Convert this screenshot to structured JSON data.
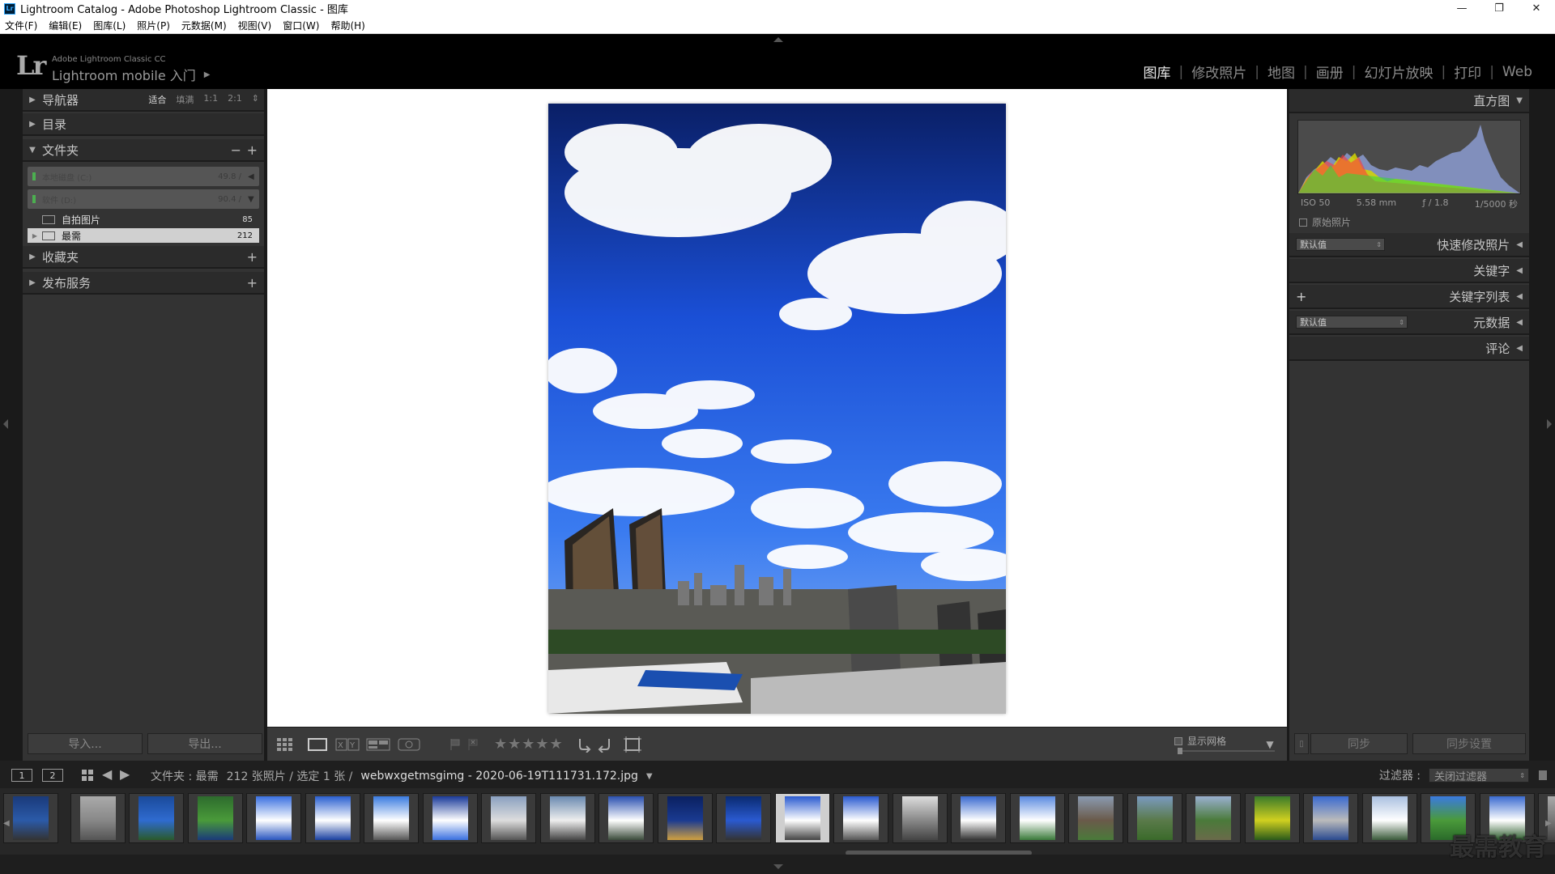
{
  "window": {
    "title": "Lightroom Catalog - Adobe Photoshop Lightroom Classic - 图库",
    "icon_label": "Lr",
    "minimize": "—",
    "restore": "❐",
    "close": "✕"
  },
  "menu": [
    "文件(F)",
    "编辑(E)",
    "图库(L)",
    "照片(P)",
    "元数据(M)",
    "视图(V)",
    "窗口(W)",
    "帮助(H)"
  ],
  "identity": {
    "logo": "Lr",
    "product": "Adobe Lightroom Classic CC",
    "mobile": "Lightroom mobile 入门"
  },
  "modules": [
    "图库",
    "修改照片",
    "地图",
    "画册",
    "幻灯片放映",
    "打印",
    "Web"
  ],
  "active_module": "图库",
  "left_panel": {
    "navigator": {
      "label": "导航器",
      "zoom": [
        "适合",
        "填满",
        "1:1",
        "2:1"
      ]
    },
    "catalog": {
      "label": "目录"
    },
    "folders": {
      "label": "文件夹",
      "volumes": [
        {
          "name": "本地磁盘 (C:)",
          "size": "49.8 / "
        },
        {
          "name": "软件 (D:)",
          "size": "90.4 / "
        }
      ],
      "items": [
        {
          "name": "自拍图片",
          "count": "85"
        },
        {
          "name": "最需",
          "count": "212"
        }
      ]
    },
    "collections": {
      "label": "收藏夹"
    },
    "publish": {
      "label": "发布服务"
    },
    "import_label": "导入...",
    "export_label": "导出..."
  },
  "right_panel": {
    "histogram": {
      "label": "直方图",
      "iso": "ISO 50",
      "focal": "5.58 mm",
      "aperture": "ƒ / 1.8",
      "shutter": "1/5000 秒"
    },
    "original_photo": "原始照片",
    "quick_develop": {
      "label": "快速修改照片",
      "preset": "默认值"
    },
    "keywording": {
      "label": "关键字"
    },
    "keyword_list": {
      "label": "关键字列表"
    },
    "metadata": {
      "label": "元数据",
      "preset": "默认值"
    },
    "comments": {
      "label": "评论"
    },
    "sync_label": "同步",
    "sync_settings_label": "同步设置"
  },
  "toolbar": {
    "stars": "★★★★★",
    "show_grid": "显示网格"
  },
  "filmstrip": {
    "screen1": "1",
    "screen2": "2",
    "breadcrumb_folder": "文件夹 : 最需",
    "count": "212 张照片 / 选定 1 张 /",
    "file_name": "webwxgetmsgimg - 2020-06-19T111731.172.jpg",
    "filter_label": "过滤器 :",
    "filter_value": "关闭过滤器"
  },
  "watermark": "最需教育",
  "colors": {
    "accent_active": "#e8e8e8",
    "panel_bg": "#333333",
    "header_bg": "#000000"
  }
}
